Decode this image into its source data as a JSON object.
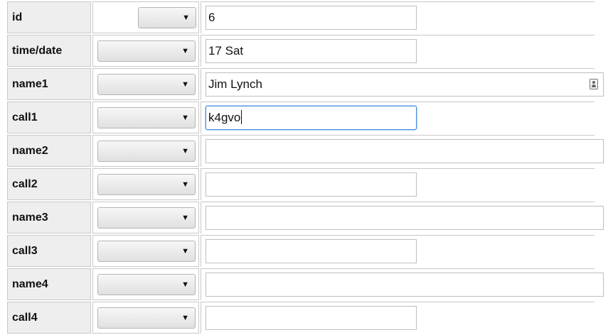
{
  "form": {
    "rows": [
      {
        "label": "id",
        "value": "6",
        "arrow": "▼"
      },
      {
        "label": "time/date",
        "value": "17 Sat",
        "arrow": "▼"
      },
      {
        "label": "name1",
        "value": "Jim Lynch",
        "arrow": "▼"
      },
      {
        "label": "call1",
        "value": "k4gvo",
        "arrow": "▼"
      },
      {
        "label": "name2",
        "value": "",
        "arrow": "▼"
      },
      {
        "label": "call2",
        "value": "",
        "arrow": "▼"
      },
      {
        "label": "name3",
        "value": "",
        "arrow": "▼"
      },
      {
        "label": "call3",
        "value": "",
        "arrow": "▼"
      },
      {
        "label": "name4",
        "value": "",
        "arrow": "▼"
      },
      {
        "label": "call4",
        "value": "",
        "arrow": "▼"
      }
    ]
  },
  "icons": {
    "dropdown": "chevron-down-icon",
    "autofill": "contact-card-icon"
  },
  "colors": {
    "label_bg": "#eeeeee",
    "focus_border": "#4a90d9"
  }
}
